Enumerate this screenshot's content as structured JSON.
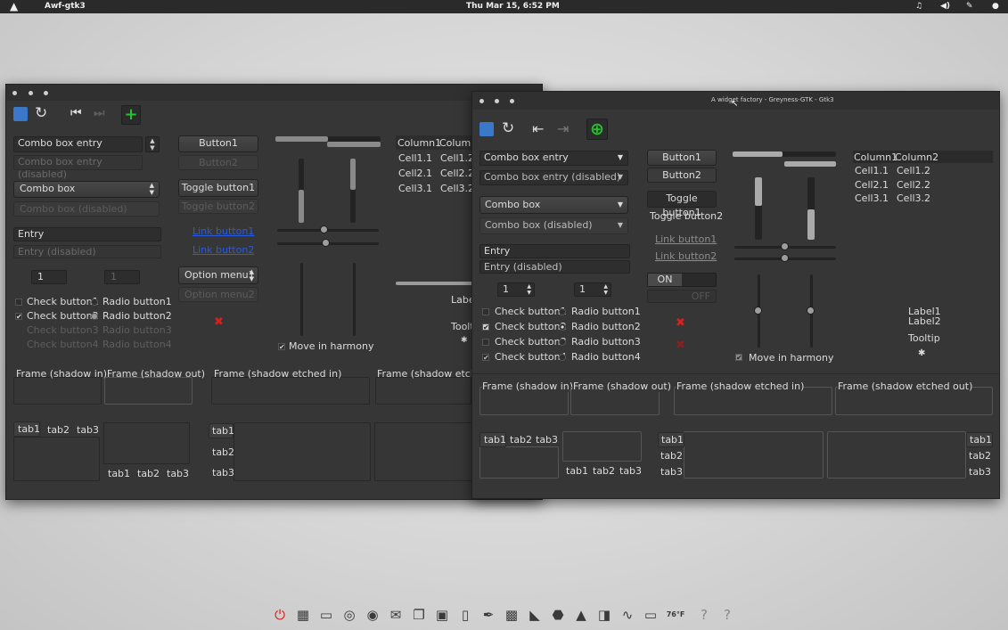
{
  "topbar": {
    "app": "Awf-gtk3",
    "clock": "Thu Mar 15,  6:52 PM",
    "icons": [
      "music-note-icon",
      "volume-icon",
      "pen-icon",
      "chat-icon"
    ]
  },
  "win1": {
    "combo_entry": "Combo box entry",
    "combo_entry_disabled": "Combo box entry (disabled)",
    "combo": "Combo box",
    "combo_disabled": "Combo box (disabled)",
    "entry": "Entry",
    "entry_disabled": "Entry (disabled)",
    "spin1": "1",
    "spin2": "1",
    "check1": "Check button1",
    "check2": "Check button2",
    "check3": "Check button3",
    "check4": "Check button4",
    "radio1": "Radio button1",
    "radio2": "Radio button2",
    "radio3": "Radio button3",
    "radio4": "Radio button4",
    "button1": "Button1",
    "button2": "Button2",
    "toggle1": "Toggle button1",
    "toggle2": "Toggle button2",
    "link1": "Link button1",
    "link2": "Link button2",
    "option1": "Option menu1",
    "option2": "Option menu2",
    "move_harmony": "Move in harmony",
    "col1": "Column1",
    "col2": "Column2",
    "rows": [
      [
        "Cell1.1",
        "Cell1.2"
      ],
      [
        "Cell2.1",
        "Cell2.2"
      ],
      [
        "Cell3.1",
        "Cell3.2"
      ]
    ],
    "label": "Label",
    "tooltip": "Tooltip",
    "frame_in": "Frame (shadow in)",
    "frame_out": "Frame (shadow out)",
    "frame_etched_in": "Frame (shadow etched in)",
    "frame_etched_out": "Frame (shadow etched",
    "tab1": "tab1",
    "tab2": "tab2",
    "tab3": "tab3"
  },
  "win2": {
    "title": "A widget factory - Greyness-GTK - Gtk3",
    "combo_entry": "Combo box entry",
    "combo_entry_disabled": "Combo box entry (disabled)",
    "combo": "Combo box",
    "combo_disabled": "Combo box (disabled)",
    "entry": "Entry",
    "entry_disabled": "Entry (disabled)",
    "spin1": "1",
    "spin2": "1",
    "check1": "Check button1",
    "check2": "Check button2",
    "check3": "Check button3",
    "check4": "Check button4",
    "radio1": "Radio button1",
    "radio2": "Radio button2",
    "radio3": "Radio button3",
    "radio4": "Radio button4",
    "button1": "Button1",
    "button2": "Button2",
    "toggle1": "Toggle button1",
    "toggle2": "Toggle button2",
    "link1": "Link button1",
    "link2": "Link button2",
    "switch_on": "ON",
    "switch_off": "OFF",
    "move_harmony": "Move in harmony",
    "col1": "Column1",
    "col2": "Column2",
    "rows": [
      [
        "Cell1.1",
        "Cell1.2"
      ],
      [
        "Cell2.1",
        "Cell2.2"
      ],
      [
        "Cell3.1",
        "Cell3.2"
      ]
    ],
    "label1": "Label1",
    "label2": "Label2",
    "tooltip": "Tooltip",
    "frame_in": "Frame (shadow in)",
    "frame_out": "Frame (shadow out)",
    "frame_etched_in": "Frame (shadow etched in)",
    "frame_etched_out": "Frame (shadow etched out)",
    "tab1": "tab1",
    "tab2": "tab2",
    "tab3": "tab3"
  },
  "dock": {
    "weather": "76°F",
    "icons": [
      "power-icon",
      "calendar-icon",
      "terminal-icon",
      "chrome-icon",
      "firefox-icon",
      "mail-icon",
      "files-icon",
      "monitor-icon",
      "document-icon",
      "pen-icon",
      "calculator-icon",
      "shoe-icon",
      "hat-icon",
      "terminal-icon",
      "window-icon",
      "activity-icon",
      "display-icon",
      "weather-icon",
      "help-icon",
      "help-icon"
    ]
  }
}
